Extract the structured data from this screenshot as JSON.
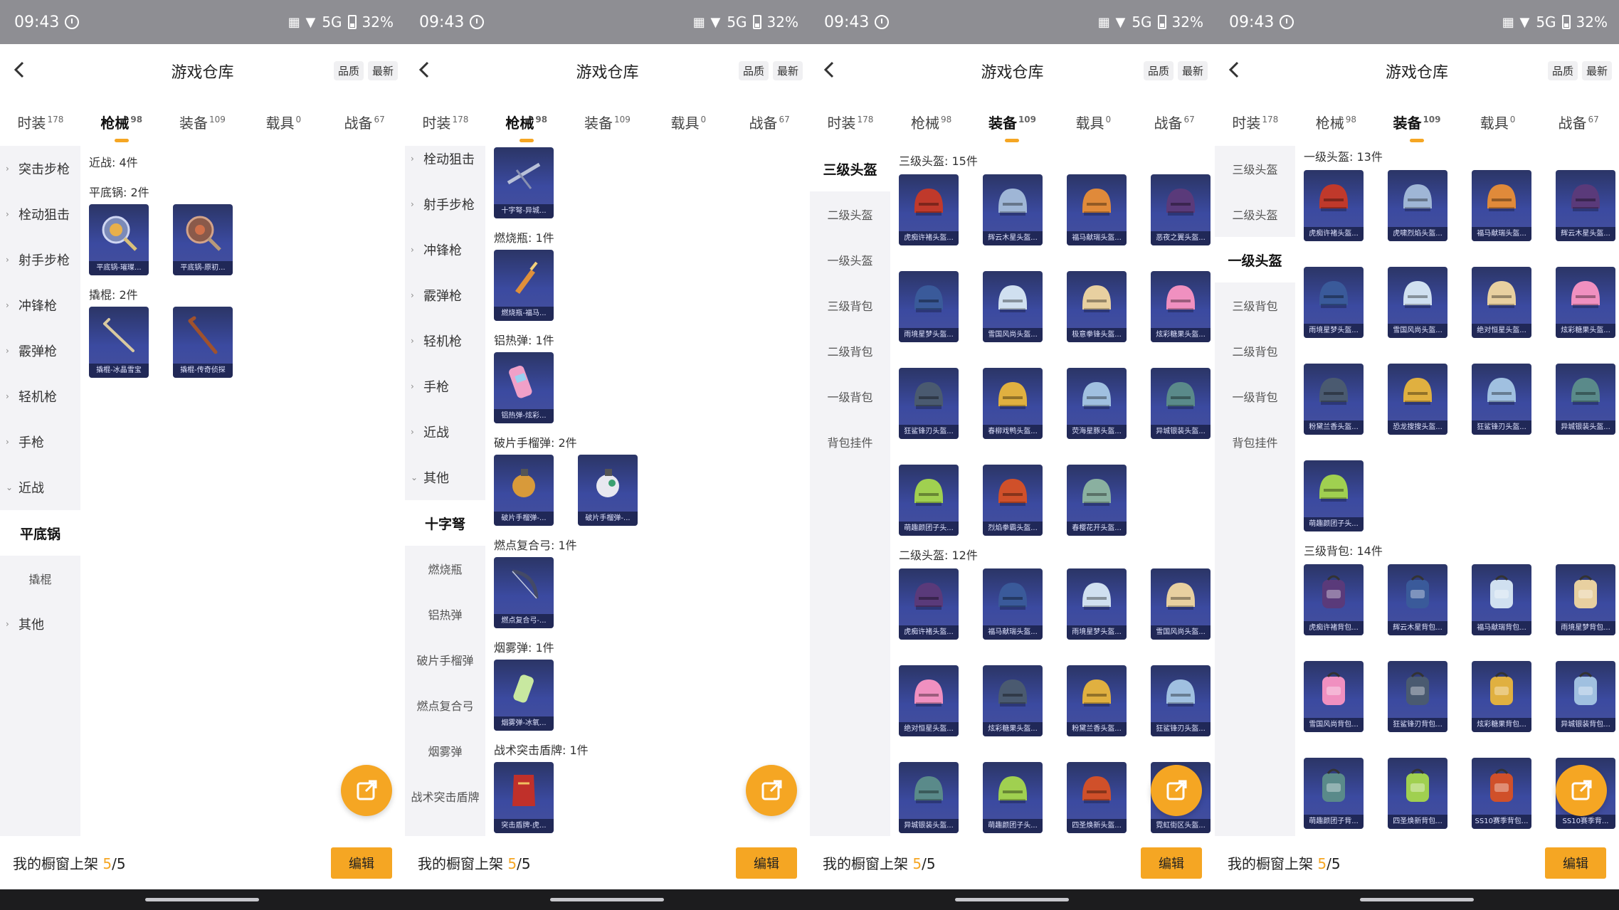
{
  "status": {
    "time": "09:43",
    "signal": "5G",
    "battery": "32%"
  },
  "header": {
    "title": "游戏仓库",
    "sort_quality": "品质",
    "sort_latest": "最新"
  },
  "tabs": [
    {
      "label": "时装",
      "count": "178"
    },
    {
      "label": "枪械",
      "count": "98"
    },
    {
      "label": "装备",
      "count": "109"
    },
    {
      "label": "载具",
      "count": "0"
    },
    {
      "label": "战备",
      "count": "67"
    }
  ],
  "footer": {
    "label": "我的橱窗上架",
    "used": "5",
    "total": "/5",
    "edit": "编辑"
  },
  "panel1": {
    "sidebar": [
      "突击步枪",
      "栓动狙击",
      "射手步枪",
      "冲锋枪",
      "霰弹枪",
      "轻机枪",
      "手枪",
      "近战"
    ],
    "sidebar_selected": "平底锅",
    "sidebar_sub": "撬棍",
    "sidebar_other": "其他",
    "summary": "近战: 4件",
    "groups": [
      {
        "title": "平底锅: 2件",
        "items": [
          "平底锅-璀璨...",
          "平底锅-原初..."
        ]
      },
      {
        "title": "撬棍: 2件",
        "items": [
          "撬棍-冰晶雪宝",
          "撬棍-传奇侦探"
        ]
      }
    ]
  },
  "panel2": {
    "sidebar": [
      "栓动狙击",
      "射手步枪",
      "冲锋枪",
      "霰弹枪",
      "轻机枪",
      "手枪",
      "近战",
      "其他"
    ],
    "sidebar_selected": "十字弩",
    "sidebar_subs": [
      "燃烧瓶",
      "铝热弹",
      "破片手榴弹",
      "燃点复合弓",
      "烟雾弹",
      "战术突击盾牌"
    ],
    "top_item": "十字弩-异城...",
    "groups": [
      {
        "title": "燃烧瓶: 1件",
        "items": [
          "燃烧瓶-福马..."
        ]
      },
      {
        "title": "铝热弹: 1件",
        "items": [
          "铝热弹-炫彩..."
        ]
      },
      {
        "title": "破片手榴弹: 2件",
        "items": [
          "破片手榴弹-...",
          "破片手榴弹-..."
        ]
      },
      {
        "title": "燃点复合弓: 1件",
        "items": [
          "燃点复合弓-..."
        ]
      },
      {
        "title": "烟雾弹: 1件",
        "items": [
          "烟雾弹-冰氧..."
        ]
      },
      {
        "title": "战术突击盾牌: 1件",
        "items": [
          "突击盾牌-虎..."
        ]
      }
    ]
  },
  "panel3": {
    "sidebar": [
      "三级头盔",
      "二级头盔",
      "一级头盔",
      "三级背包",
      "二级背包",
      "一级背包",
      "背包挂件"
    ],
    "groups": [
      {
        "title": "三级头盔: 15件",
        "items": [
          "虎痴许褚头盔...",
          "辉云木星头盔...",
          "福马献瑞头盔...",
          "恶夜之翼头盔...",
          "雨境星梦头盔...",
          "雪国风尚头盔...",
          "极意拳锋头盔...",
          "炫彩糖果头盔...",
          "狂鲨锋刃头盔...",
          "春柳戏鸭头盔...",
          "荧海星豚头盔...",
          "异城银装头盔...",
          "萌趣颜团子头...",
          "烈焰拳霸头盔...",
          "春樱花开头盔..."
        ]
      },
      {
        "title": "二级头盔: 12件",
        "items": [
          "虎痴许褚头盔...",
          "福马献瑞头盔...",
          "雨境星梦头盔...",
          "雪国风尚头盔...",
          "绝对恒星头盔...",
          "炫彩糖果头盔...",
          "粉黛兰香头盔...",
          "狂鲨锋刃头盔...",
          "异城银装头盔...",
          "萌趣颜团子头...",
          "四圣焕新头盔...",
          "霓虹街区头盔..."
        ]
      }
    ]
  },
  "panel4": {
    "sidebar": [
      "三级头盔",
      "二级头盔",
      "一级头盔",
      "三级背包",
      "二级背包",
      "一级背包",
      "背包挂件"
    ],
    "groups": [
      {
        "title": "一级头盔: 13件",
        "items": [
          "虎痴许褚头盔...",
          "虎啸烈焰头盔...",
          "福马献瑞头盔...",
          "辉云木星头盔...",
          "雨境星梦头盔...",
          "雪国风尚头盔...",
          "绝对恒星头盔...",
          "炫彩糖果头盔...",
          "粉黛兰香头盔...",
          "恐龙搜搜头盔...",
          "狂鲨锋刃头盔...",
          "异城银装头盔...",
          "萌趣颜团子头..."
        ]
      },
      {
        "title": "三级背包: 14件",
        "items": [
          "虎痴许褚背包...",
          "辉云木星背包...",
          "福马献瑞背包...",
          "雨境星梦背包...",
          "雪国风尚背包...",
          "狂鲨锋刃背包...",
          "炫彩糖果背包...",
          "异城银装背包...",
          "萌趣颜团子背...",
          "四圣焕新背包...",
          "SS10赛季背包...",
          "SS10赛季背..."
        ]
      }
    ]
  },
  "colors": {
    "accent": "#f5a623",
    "card_top": "#2b3566",
    "card_bottom": "#46509c",
    "statusbar": "#8e8e93"
  }
}
